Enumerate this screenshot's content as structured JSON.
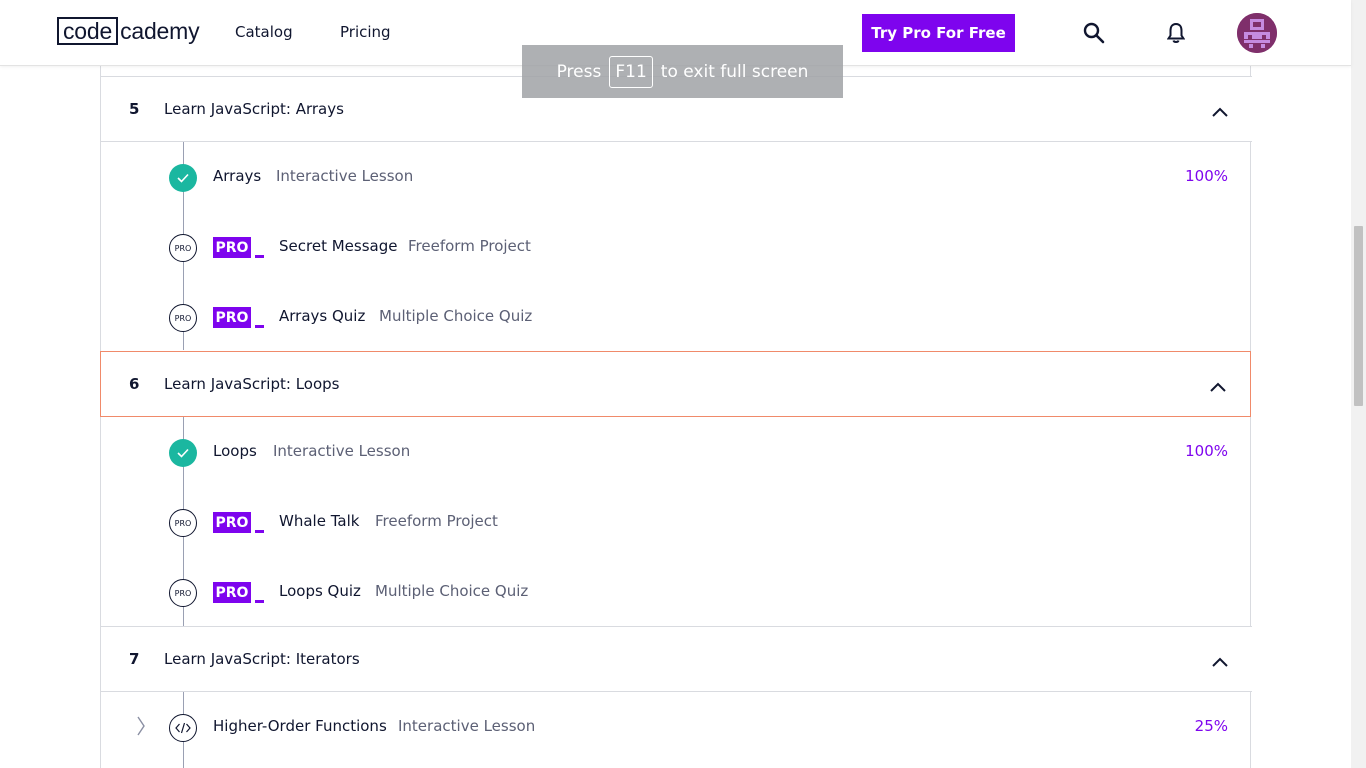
{
  "header": {
    "logo_code": "code",
    "logo_rest": "cademy",
    "nav": [
      "Catalog",
      "Pricing"
    ],
    "try_pro": "Try Pro For Free"
  },
  "toast": {
    "press": "Press",
    "key": "F11",
    "rest": "to exit full screen"
  },
  "modules": [
    {
      "num": "5",
      "title": "Learn JavaScript: Arrays",
      "items": [
        {
          "status": "complete",
          "title": "Arrays",
          "type": "Interactive Lesson",
          "percent": "100%"
        },
        {
          "status": "pro",
          "badge": "PRO",
          "title": "Secret Message",
          "type": "Freeform Project"
        },
        {
          "status": "pro",
          "badge": "PRO",
          "title": "Arrays Quiz",
          "type": "Multiple Choice Quiz"
        }
      ]
    },
    {
      "num": "6",
      "title": "Learn JavaScript: Loops",
      "items": [
        {
          "status": "complete",
          "title": "Loops",
          "type": "Interactive Lesson",
          "percent": "100%"
        },
        {
          "status": "pro",
          "badge": "PRO",
          "title": "Whale Talk",
          "type": "Freeform Project"
        },
        {
          "status": "pro",
          "badge": "PRO",
          "title": "Loops Quiz",
          "type": "Multiple Choice Quiz"
        }
      ]
    },
    {
      "num": "7",
      "title": "Learn JavaScript: Iterators",
      "items": [
        {
          "status": "in-progress",
          "title": "Higher-Order Functions",
          "type": "Interactive Lesson",
          "percent": "25%"
        }
      ]
    }
  ],
  "pro_circle_label": "PRO",
  "colors": {
    "brand": "#7e04ee",
    "complete": "#1bb7a0",
    "focus": "#f08a6a"
  }
}
